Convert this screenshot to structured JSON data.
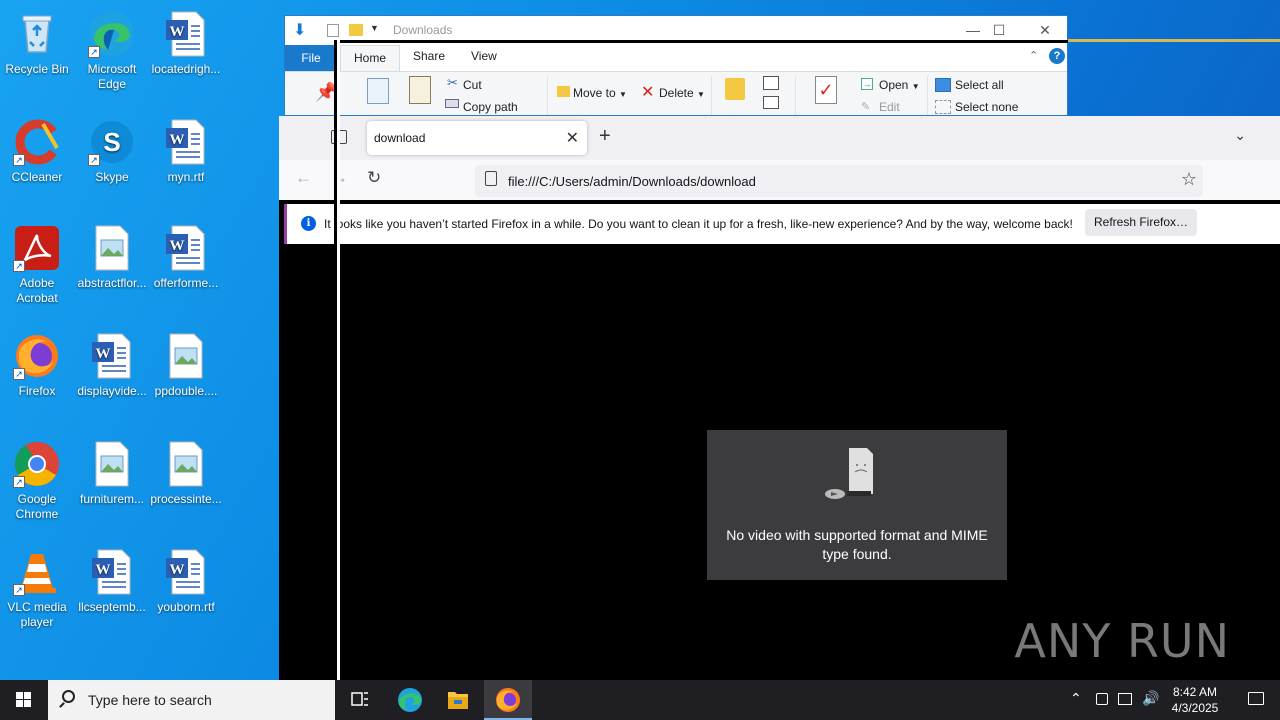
{
  "desktop": {
    "icons": [
      {
        "label": "Recycle Bin"
      },
      {
        "label": "Microsoft Edge"
      },
      {
        "label": "locatedrigh..."
      },
      {
        "label": "CCleaner"
      },
      {
        "label": "Skype"
      },
      {
        "label": "myn.rtf"
      },
      {
        "label": "Adobe Acrobat"
      },
      {
        "label": "abstractflor..."
      },
      {
        "label": "offerforme..."
      },
      {
        "label": "Firefox"
      },
      {
        "label": "displayvide..."
      },
      {
        "label": "ppdouble...."
      },
      {
        "label": "Google Chrome"
      },
      {
        "label": "furniturem..."
      },
      {
        "label": "processinte..."
      },
      {
        "label": "VLC media player"
      },
      {
        "label": "llcseptemb..."
      },
      {
        "label": "youborn.rtf"
      }
    ]
  },
  "explorer": {
    "title": "Downloads",
    "tabs": {
      "file": "File",
      "home": "Home",
      "share": "Share",
      "view": "View"
    },
    "ribbon": {
      "cut": "Cut",
      "copy_path": "Copy path",
      "move_to": "Move to",
      "delete": "Delete",
      "open": "Open",
      "edit": "Edit",
      "select_all": "Select all",
      "select_none": "Select none"
    }
  },
  "firefox": {
    "tab_title": "download",
    "url": "file:///C:/Users/admin/Downloads/download",
    "notification": "It looks like you haven’t started Firefox in a while. Do you want to clean it up for a fresh, like-new experience? And by the way, welcome back!",
    "refresh_button": "Refresh Firefox…",
    "video_error": "No video with supported format and MIME type found.",
    "watermark": "ANY RUN"
  },
  "taskbar": {
    "search_placeholder": "Type here to search",
    "time": "8:42 AM",
    "date": "4/3/2025"
  }
}
